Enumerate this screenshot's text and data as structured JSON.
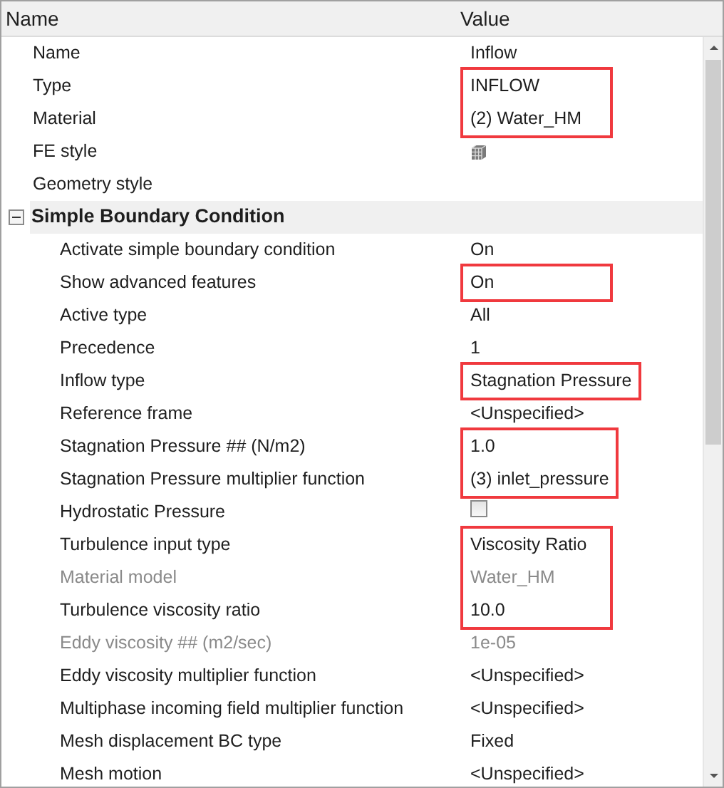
{
  "columns": [
    "Name",
    "Value"
  ],
  "items": [
    {
      "kind": "text",
      "name": "Name",
      "value": "Inflow"
    },
    {
      "kind": "highlight",
      "rows": [
        {
          "kind": "text",
          "name": "Type",
          "value": "INFLOW"
        },
        {
          "kind": "text",
          "name": "Material",
          "value": "(2) Water_HM"
        }
      ]
    },
    {
      "kind": "icon",
      "name": "FE style"
    },
    {
      "kind": "text",
      "name": "Geometry style"
    },
    {
      "kind": "group",
      "name": "Simple Boundary Condition",
      "expanded": true,
      "children": [
        {
          "kind": "text",
          "name": "Activate simple boundary condition",
          "value": "On"
        },
        {
          "kind": "highlight",
          "rows": [
            {
              "kind": "text",
              "name": "Show advanced features",
              "value": "On"
            }
          ]
        },
        {
          "kind": "text",
          "name": "Active type",
          "value": "All"
        },
        {
          "kind": "text",
          "name": "Precedence",
          "value": "1"
        },
        {
          "kind": "highlight",
          "rows": [
            {
              "kind": "text",
              "name": "Inflow type",
              "value": "Stagnation Pressure"
            }
          ]
        },
        {
          "kind": "text",
          "name": "Reference frame",
          "value": "<Unspecified>"
        },
        {
          "kind": "highlight",
          "rows": [
            {
              "kind": "text",
              "name": "Stagnation Pressure ## (N/m2)",
              "value": "1.0"
            },
            {
              "kind": "text",
              "name": "Stagnation Pressure multiplier function",
              "value": "(3) inlet_pressure"
            }
          ]
        },
        {
          "kind": "checkbox",
          "name": "Hydrostatic Pressure",
          "checked": false
        },
        {
          "kind": "highlight",
          "rows": [
            {
              "kind": "text",
              "name": "Turbulence input type",
              "value": "Viscosity Ratio"
            },
            {
              "kind": "text",
              "name": "Material model",
              "value": "Water_HM",
              "disabled": true
            },
            {
              "kind": "text",
              "name": "Turbulence viscosity ratio",
              "value": "10.0"
            }
          ]
        },
        {
          "kind": "text",
          "name": "Eddy viscosity ## (m2/sec)",
          "value": "1e-05",
          "disabled": true
        },
        {
          "kind": "text",
          "name": "Eddy viscosity multiplier function",
          "value": "<Unspecified>"
        },
        {
          "kind": "text",
          "name": "Multiphase incoming field multiplier function",
          "value": "<Unspecified>"
        },
        {
          "kind": "text",
          "name": "Mesh displacement BC type",
          "value": "Fixed"
        },
        {
          "kind": "text",
          "name": "Mesh motion",
          "value": "<Unspecified>"
        }
      ]
    }
  ]
}
